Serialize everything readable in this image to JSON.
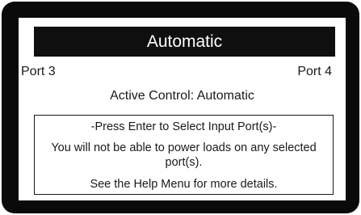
{
  "screen": {
    "title": "Automatic",
    "port_left": "Port 3",
    "port_right": "Port 4",
    "active_control": "Active Control: Automatic",
    "message": {
      "line1": "-Press Enter to Select Input Port(s)-",
      "line2": "You will not be able to power loads on any selected port(s).",
      "line3": "See the Help Menu for more details."
    }
  },
  "colors": {
    "bezel": "#0a0a0a",
    "screen_background": "#ffffff",
    "title_bar": "#0f0f0f",
    "title_text": "#ffffff",
    "text": "#1a1a1a"
  }
}
